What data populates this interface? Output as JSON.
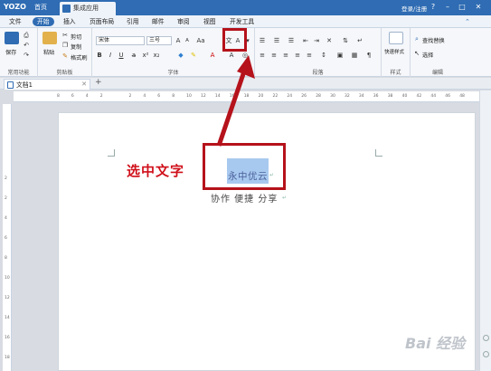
{
  "titlebar": {
    "logo": "YOZO",
    "home_tab": "首页",
    "app_tab": "集成应用",
    "login": "登录/注册"
  },
  "menubar": [
    "文件",
    "开始",
    "插入",
    "页面布局",
    "引用",
    "邮件",
    "审阅",
    "视图",
    "开发工具"
  ],
  "menubar_active_index": 1,
  "ribbon": {
    "save": "保存",
    "paste": "粘贴",
    "cut": "剪切",
    "copy": "复制",
    "format_painter": "格式刷",
    "font_name": "宋体",
    "font_size": "三号",
    "font_size_grow": "A",
    "font_size_shrink": "A",
    "change_case": "Aa",
    "bold": "B",
    "italic": "I",
    "underline": "U",
    "quick_styles": "快速样式",
    "find_replace": "查找替换",
    "select": "选择",
    "groups": {
      "common": "常用功能",
      "clipboard": "剪贴板",
      "font": "字体",
      "paragraph": "段落",
      "styles": "样式",
      "editing": "编辑"
    }
  },
  "doc_tab": "文档1",
  "new_tab": "+",
  "ruler_ticks": [
    "8",
    "6",
    "4",
    "2",
    "",
    "2",
    "4",
    "6",
    "8",
    "10",
    "12",
    "14",
    "16",
    "18",
    "20",
    "22",
    "24",
    "26",
    "28",
    "30",
    "32",
    "34",
    "36",
    "38",
    "40",
    "42",
    "44",
    "46",
    "48"
  ],
  "vruler_ticks": [
    "2",
    "2",
    "4",
    "6",
    "8",
    "10",
    "12",
    "14",
    "16",
    "18"
  ],
  "document": {
    "emphasis_dots": "· · · ·",
    "selected_text": "永中优云",
    "line2": "协作 便捷 分享"
  },
  "annotation": {
    "label": "选中文字",
    "color": "#b5121b"
  },
  "watermark": "Bai 经验",
  "colors": {
    "titlebar": "#2f6cb3",
    "accent": "#2f6cb3",
    "selection": "#a8c9ef",
    "annotation_red": "#b5121b"
  }
}
